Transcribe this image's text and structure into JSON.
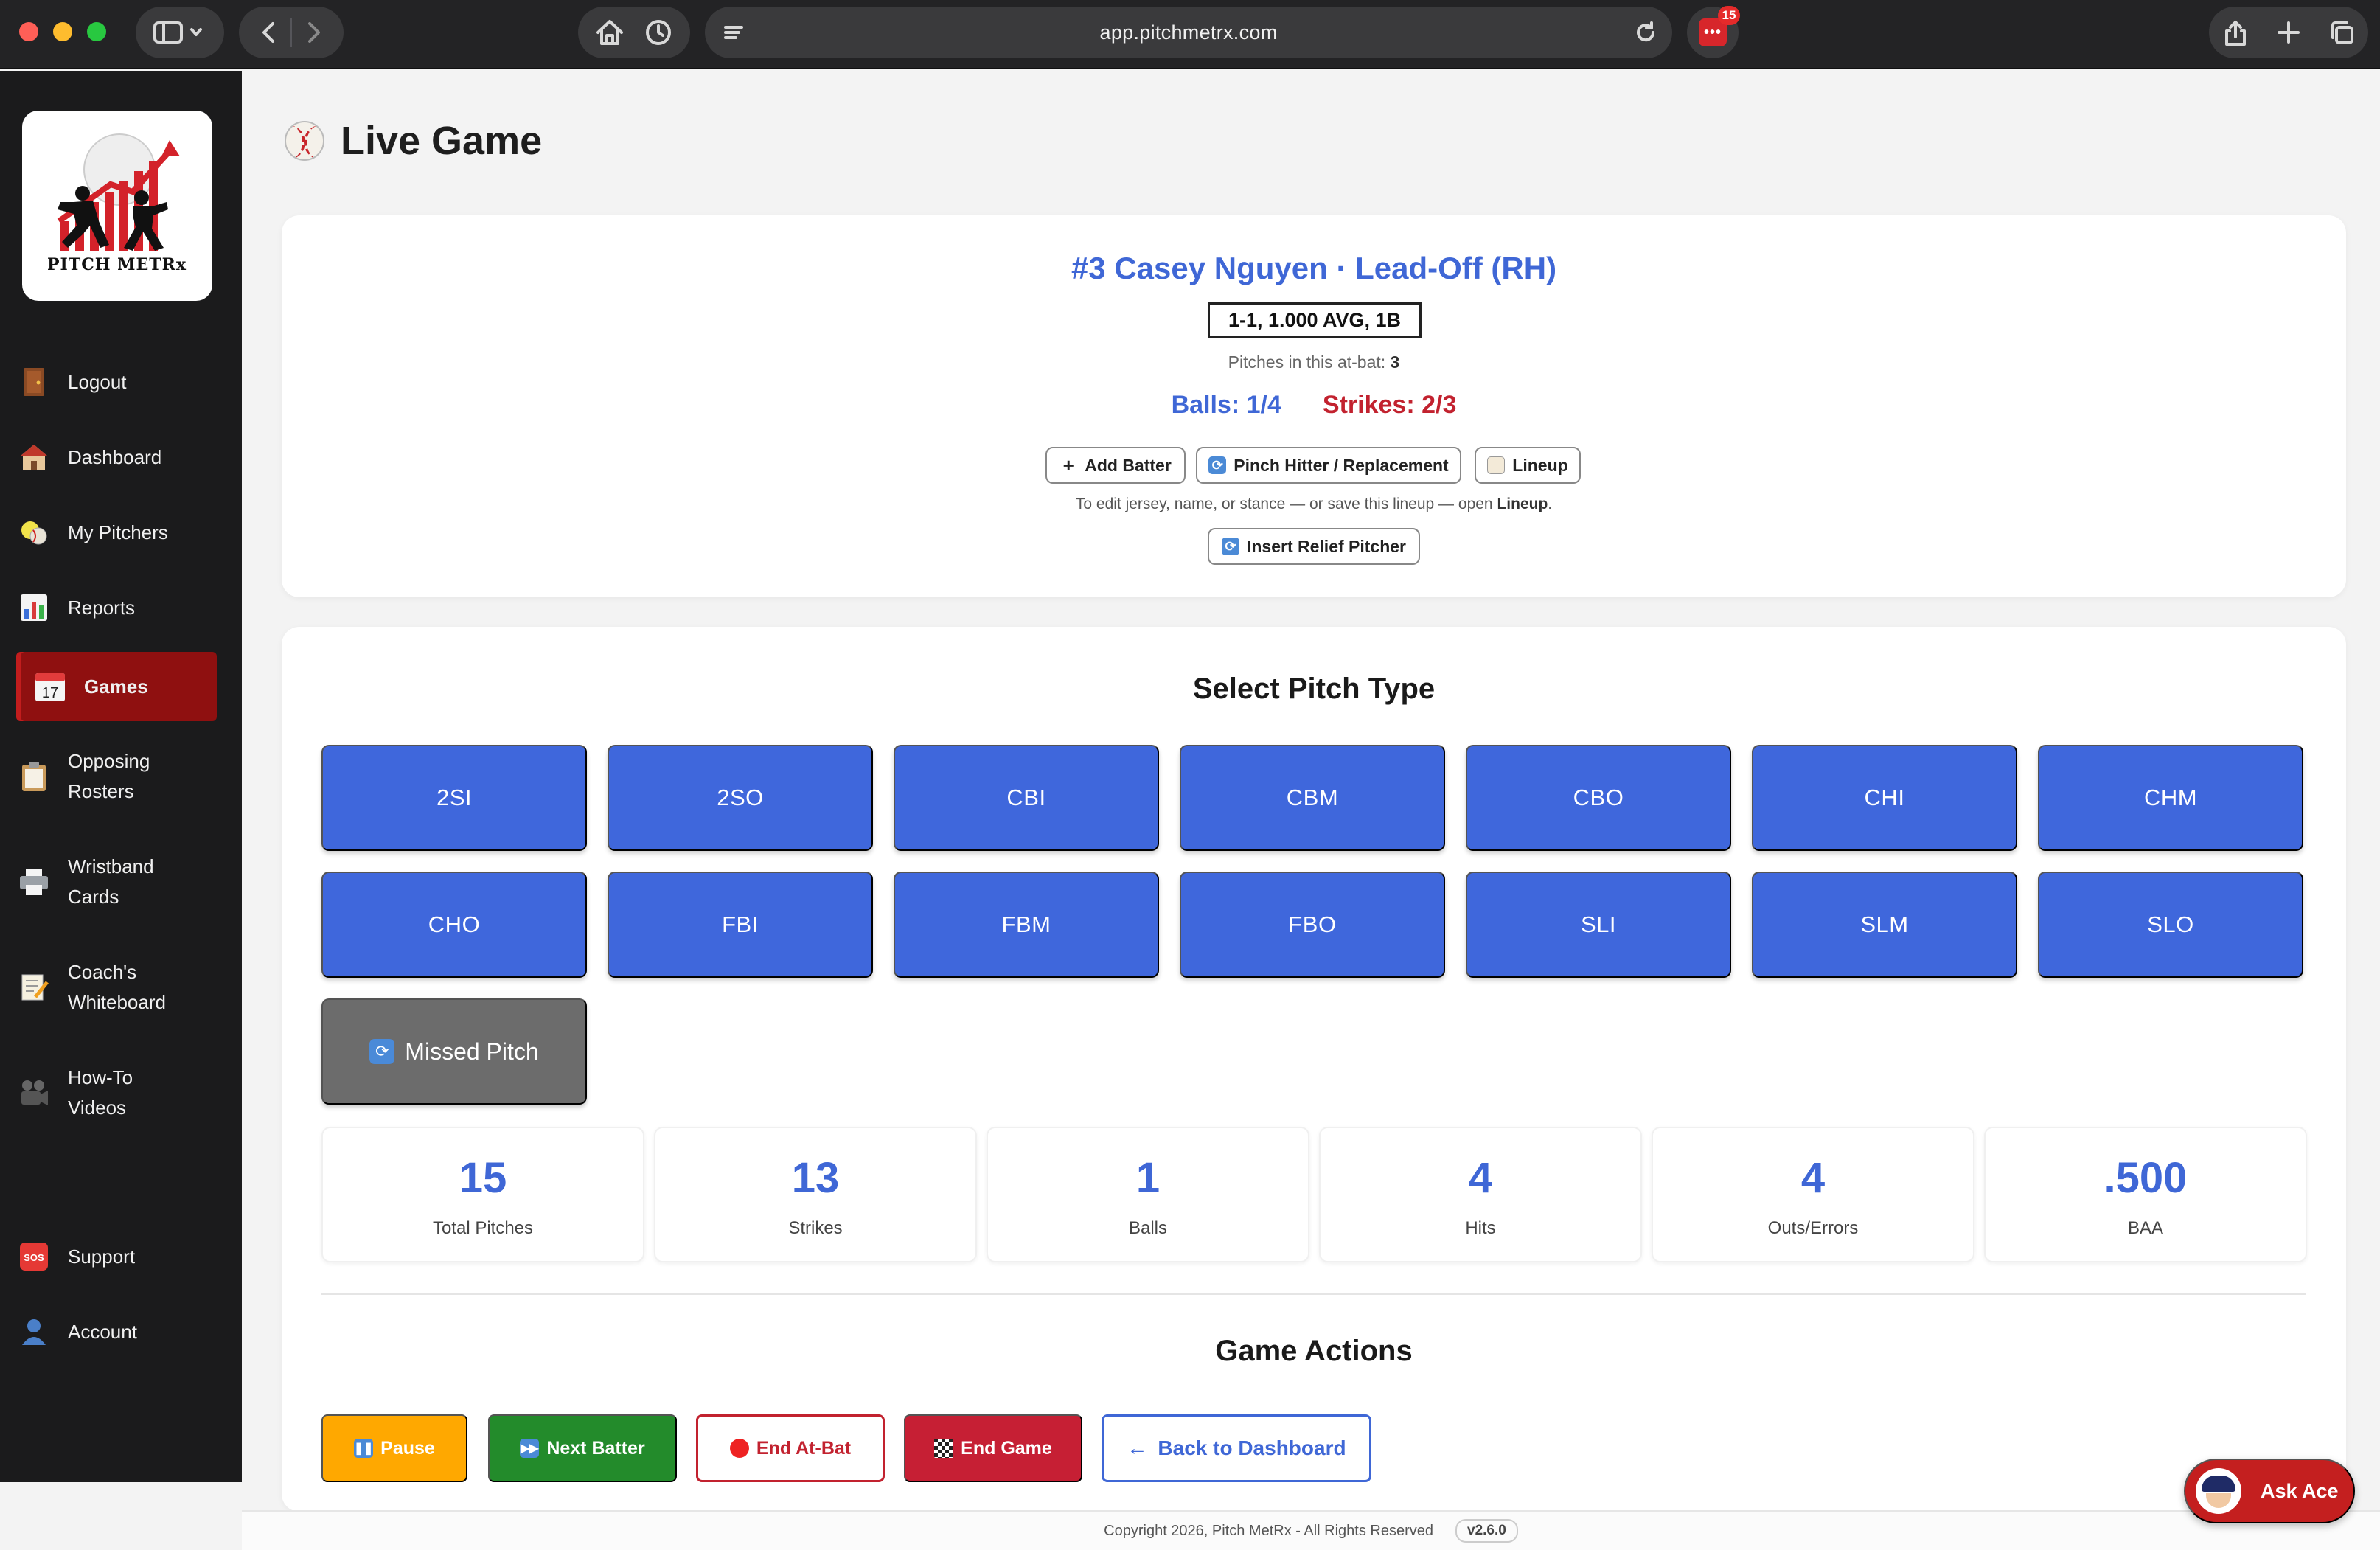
{
  "browser": {
    "url": "app.pitchmetrx.com",
    "extension_badge": "15",
    "extension_icon": "•••"
  },
  "sidebar": {
    "logo_text": "PITCH METRx",
    "items": [
      {
        "label": "Logout",
        "icon": "door-icon"
      },
      {
        "label": "Dashboard",
        "icon": "house-icon"
      },
      {
        "label": "My Pitchers",
        "icon": "baseball-icon"
      },
      {
        "label": "Reports",
        "icon": "bar-chart-icon"
      },
      {
        "label": "Games",
        "icon": "calendar-icon",
        "active": true,
        "icon_text": "17"
      },
      {
        "label": "Opposing Rosters",
        "icon": "clipboard-icon"
      },
      {
        "label": "Wristband Cards",
        "icon": "printer-icon"
      },
      {
        "label": "Coach's Whiteboard",
        "icon": "memo-icon"
      },
      {
        "label": "How-To Videos",
        "icon": "video-camera-icon"
      },
      {
        "label": "Support",
        "icon": "sos-icon",
        "icon_text": "SOS"
      },
      {
        "label": "Account",
        "icon": "person-icon"
      }
    ]
  },
  "page": {
    "title": "Live Game"
  },
  "batter": {
    "name": "#3 Casey Nguyen · Lead-Off (RH)",
    "statline": "1-1, 1.000 AVG, 1B",
    "pitches_label": "Pitches in this at-bat:",
    "pitches_value": "3",
    "balls": "Balls: 1/4",
    "strikes": "Strikes: 2/3",
    "add_batter": "Add Batter",
    "pinch_hitter": "Pinch Hitter / Replacement",
    "lineup": "Lineup",
    "edit_hint_prefix": "To edit jersey, name, or stance — or save this lineup — open",
    "edit_hint_link": "Lineup",
    "edit_hint_suffix": ".",
    "insert_relief": "Insert Relief Pitcher"
  },
  "pitch_select": {
    "title": "Select Pitch Type",
    "types": [
      "2SI",
      "2SO",
      "CBI",
      "CBM",
      "CBO",
      "CHI",
      "CHM",
      "CHO",
      "FBI",
      "FBM",
      "FBO",
      "SLI",
      "SLM",
      "SLO"
    ],
    "missed_label": "Missed Pitch"
  },
  "stats": [
    {
      "value": "15",
      "label": "Total Pitches"
    },
    {
      "value": "13",
      "label": "Strikes"
    },
    {
      "value": "1",
      "label": "Balls"
    },
    {
      "value": "4",
      "label": "Hits"
    },
    {
      "value": "4",
      "label": "Outs/Errors"
    },
    {
      "value": ".500",
      "label": "BAA"
    }
  ],
  "game_actions": {
    "title": "Game Actions",
    "pause": "Pause",
    "next_batter": "Next Batter",
    "end_at_bat": "End At-Bat",
    "end_game": "End Game",
    "back": "Back to Dashboard"
  },
  "footer": {
    "copyright": "Copyright 2026, Pitch MetRx - All Rights Reserved",
    "version": "v2.6.0"
  },
  "assistant": {
    "label": "Ask Ace"
  },
  "colors": {
    "accent_blue": "#3f67dc",
    "strike_red": "#c2222f",
    "active_nav": "#8f1010",
    "pause_orange": "#ffa800",
    "next_green": "#238b2b"
  }
}
